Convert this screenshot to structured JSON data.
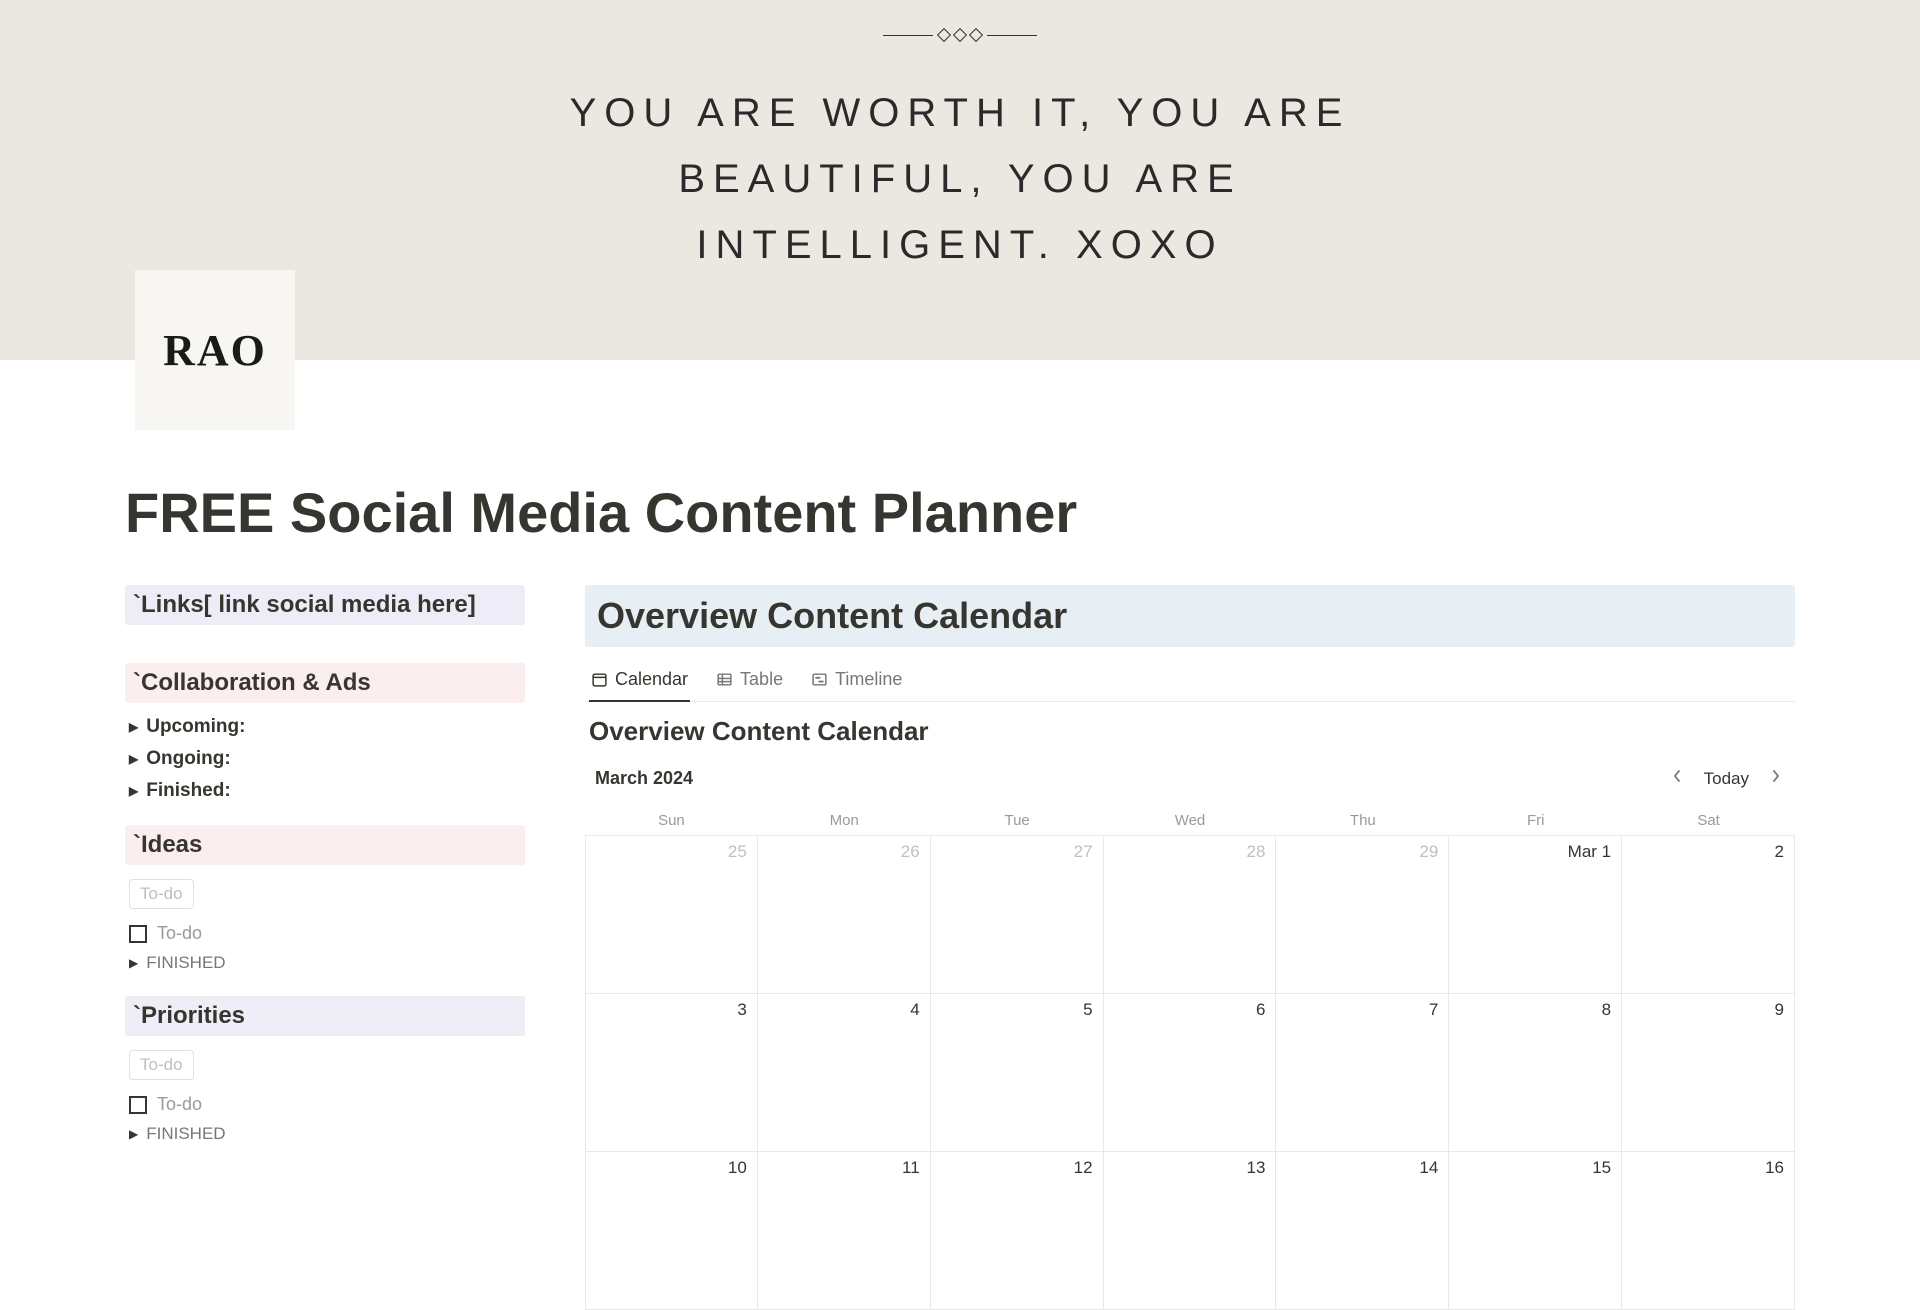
{
  "banner": {
    "quote": "YOU ARE WORTH IT, YOU ARE BEAUTIFUL, YOU ARE INTELLIGENT. XOXO",
    "logo": "RAO"
  },
  "page": {
    "title": "FREE Social Media Content Planner"
  },
  "sidebar": {
    "links_heading": "`Links[ link social media here]",
    "collab_heading": "`Collaboration & Ads",
    "collab_items": [
      "Upcoming:",
      "Ongoing:",
      "Finished:"
    ],
    "ideas_heading": "`Ideas",
    "ideas_placeholder": "To-do",
    "ideas_todo": "To-do",
    "ideas_finished": "FINISHED",
    "priorities_heading": "`Priorities",
    "priorities_placeholder": "To-do",
    "priorities_todo": "To-do",
    "priorities_finished": "FINISHED"
  },
  "main": {
    "heading": "Overview Content Calendar",
    "tabs": [
      {
        "label": "Calendar",
        "active": true
      },
      {
        "label": "Table",
        "active": false
      },
      {
        "label": "Timeline",
        "active": false
      }
    ],
    "db_title": "Overview Content Calendar",
    "calendar": {
      "month": "March 2024",
      "today_label": "Today",
      "daynames": [
        "Sun",
        "Mon",
        "Tue",
        "Wed",
        "Thu",
        "Fri",
        "Sat"
      ],
      "cells": [
        {
          "label": "25",
          "muted": true
        },
        {
          "label": "26",
          "muted": true
        },
        {
          "label": "27",
          "muted": true
        },
        {
          "label": "28",
          "muted": true
        },
        {
          "label": "29",
          "muted": true
        },
        {
          "label": "Mar 1",
          "muted": false
        },
        {
          "label": "2",
          "muted": false
        },
        {
          "label": "3",
          "muted": false
        },
        {
          "label": "4",
          "muted": false
        },
        {
          "label": "5",
          "muted": false
        },
        {
          "label": "6",
          "muted": false
        },
        {
          "label": "7",
          "muted": false
        },
        {
          "label": "8",
          "muted": false
        },
        {
          "label": "9",
          "muted": false
        },
        {
          "label": "10",
          "muted": false
        },
        {
          "label": "11",
          "muted": false
        },
        {
          "label": "12",
          "muted": false
        },
        {
          "label": "13",
          "muted": false
        },
        {
          "label": "14",
          "muted": false
        },
        {
          "label": "15",
          "muted": false
        },
        {
          "label": "16",
          "muted": false
        }
      ]
    }
  }
}
